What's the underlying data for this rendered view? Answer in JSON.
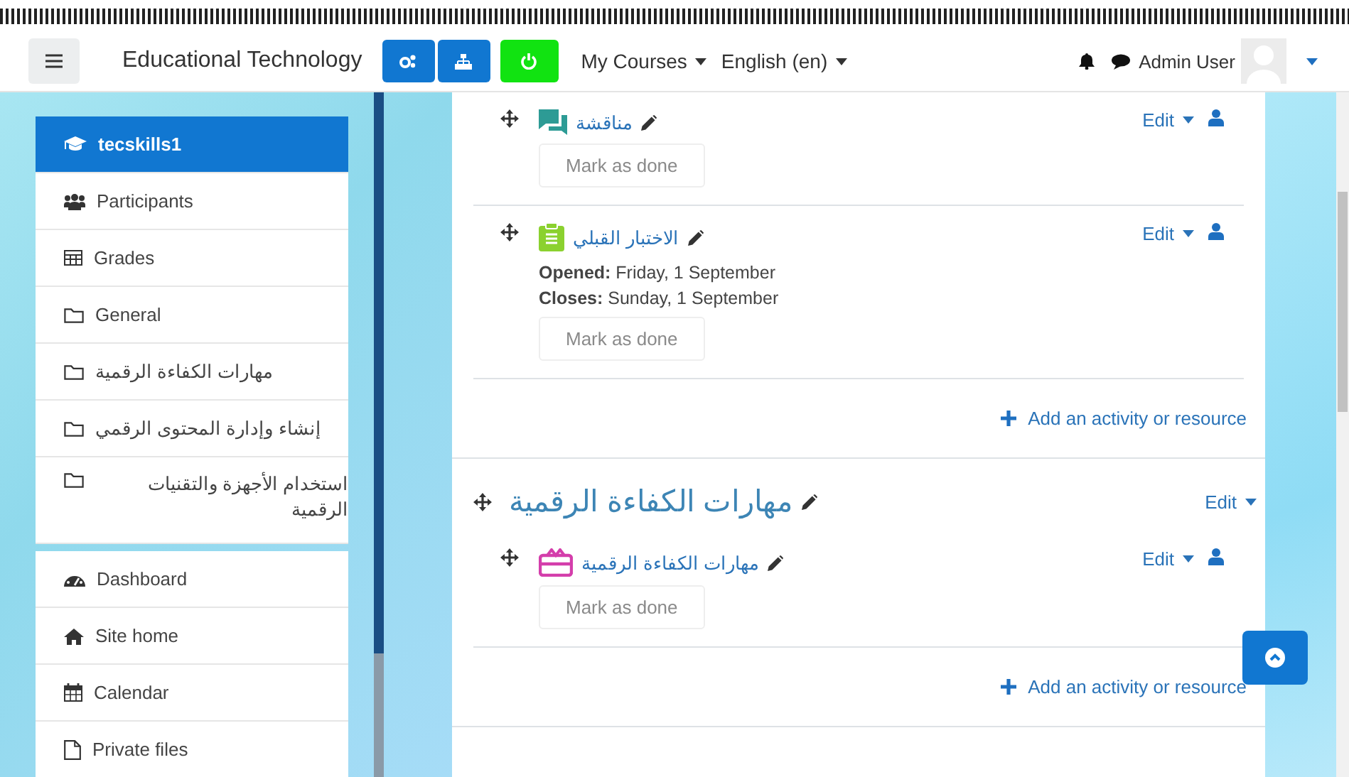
{
  "navbar": {
    "site_name": "Educational Technology",
    "buttons": [
      {
        "kind": "cogs",
        "color": "#1177d1"
      },
      {
        "kind": "sitemap",
        "color": "#1177d1"
      },
      {
        "kind": "power",
        "color": "#11e311"
      }
    ],
    "menus": [
      {
        "label": "My Courses"
      },
      {
        "label": "English (en)"
      }
    ],
    "user_name": "Admin User"
  },
  "sidebar": {
    "course": {
      "label": "tecskills1",
      "selected": true
    },
    "items": [
      {
        "kind": "users",
        "label": "Participants",
        "selected": false
      },
      {
        "kind": "table",
        "label": "Grades",
        "selected": false
      },
      {
        "kind": "folder",
        "label": "General",
        "selected": false
      },
      {
        "kind": "folder",
        "label": "مهارات الكفاءة الرقمية",
        "selected": false
      },
      {
        "kind": "folder",
        "label": "إنشاء وإدارة المحتوى الرقمي",
        "selected": false
      },
      {
        "kind": "folder",
        "label": "استخدام الأجهزة والتقنيات الرقمية",
        "selected": false
      }
    ],
    "nav": [
      {
        "kind": "dashboard",
        "label": "Dashboard",
        "selected": false
      },
      {
        "kind": "home",
        "label": "Site home",
        "selected": false
      },
      {
        "kind": "calendar",
        "label": "Calendar",
        "selected": false
      },
      {
        "kind": "file",
        "label": "Private files",
        "selected": false
      }
    ]
  },
  "sections": [
    {
      "activities": [
        {
          "kind": "forum",
          "name": "مناقشة",
          "edit": "Edit",
          "mark_button": {
            "label": "Mark as done",
            "disabled": true
          }
        },
        {
          "kind": "quiz",
          "name": "الاختبار القبلي",
          "edit": "Edit",
          "dates": [
            "**Opened:** Friday, 1 September",
            "**Closes:** Sunday, 1 September"
          ],
          "mark_button": {
            "label": "Mark as done",
            "disabled": true
          }
        }
      ],
      "add_link": "Add an activity or resource"
    },
    {
      "title": "مهارات الكفاءة الرقمية",
      "edit": "Edit",
      "activities": [
        {
          "kind": "gift",
          "name": "مهارات الكفاءة الرقمية",
          "edit": "Edit",
          "mark_button": {
            "label": "Mark as done",
            "disabled": true
          }
        }
      ],
      "add_link": "Add an activity or resource"
    }
  ]
}
